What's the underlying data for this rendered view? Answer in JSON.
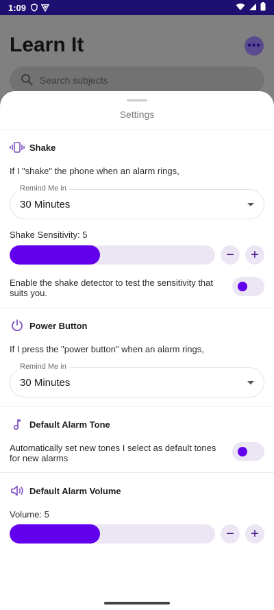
{
  "status_bar": {
    "time": "1:09"
  },
  "background": {
    "title": "Learn It",
    "more_label": "•••",
    "search_placeholder": "Search subjects"
  },
  "sheet": {
    "title": "Settings",
    "shake": {
      "heading": "Shake",
      "description": "If I \"shake\" the phone when an alarm rings,",
      "remind_label": "Remind Me in",
      "remind_value": "30 Minutes",
      "sensitivity_label": "Shake Sensitivity: 5",
      "sensitivity_value": 5,
      "sensitivity_fill": 0.44,
      "detector_text_line1": "Enable the shake detector to test the sensitivity that",
      "detector_text_line2": "suits you."
    },
    "power_button": {
      "heading": "Power Button",
      "description": "If I press the \"power button\" when an alarm rings,",
      "remind_label": "Remind Me in",
      "remind_value": "30 Minutes"
    },
    "default_tone": {
      "heading": "Default Alarm Tone",
      "text_line1": "Automatically set new tones I select as default tones",
      "text_line2": "for new alarms"
    },
    "default_volume": {
      "heading": "Default Alarm Volume",
      "volume_label": "Volume: 5",
      "volume_value": 5,
      "volume_fill": 0.44
    },
    "minus_label": "−",
    "plus_label": "+"
  },
  "colors": {
    "accent": "#6200ee",
    "track": "#ece6f4",
    "status_bar": "#1e1070",
    "icon_tint": "#7c4dbd"
  }
}
